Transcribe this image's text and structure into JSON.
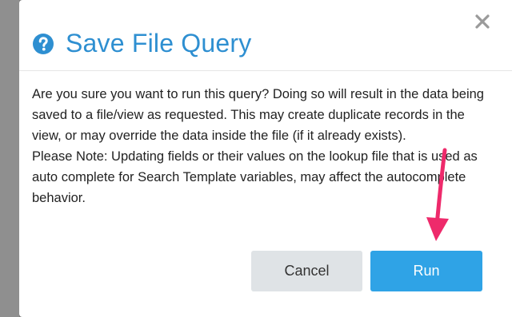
{
  "dialog": {
    "title": "Save File Query",
    "close_icon": "close-icon",
    "help_icon": "help-circle-icon",
    "message": "Are you sure you want to run this query? Doing so will result in the data being saved to a file/view as requested. This may create duplicate records in the view, or may override the data inside the file (if it already exists).",
    "note": "Please Note: Updating fields or their values on the lookup file that is used as auto complete for Search Template variables, may affect the autocomplete behavior.",
    "cancel_label": "Cancel",
    "run_label": "Run"
  },
  "colors": {
    "title": "#2e8fd1",
    "run_button": "#2fa3e6",
    "cancel_button": "#dfe3e6",
    "annotation_arrow": "#ee2a6b"
  }
}
